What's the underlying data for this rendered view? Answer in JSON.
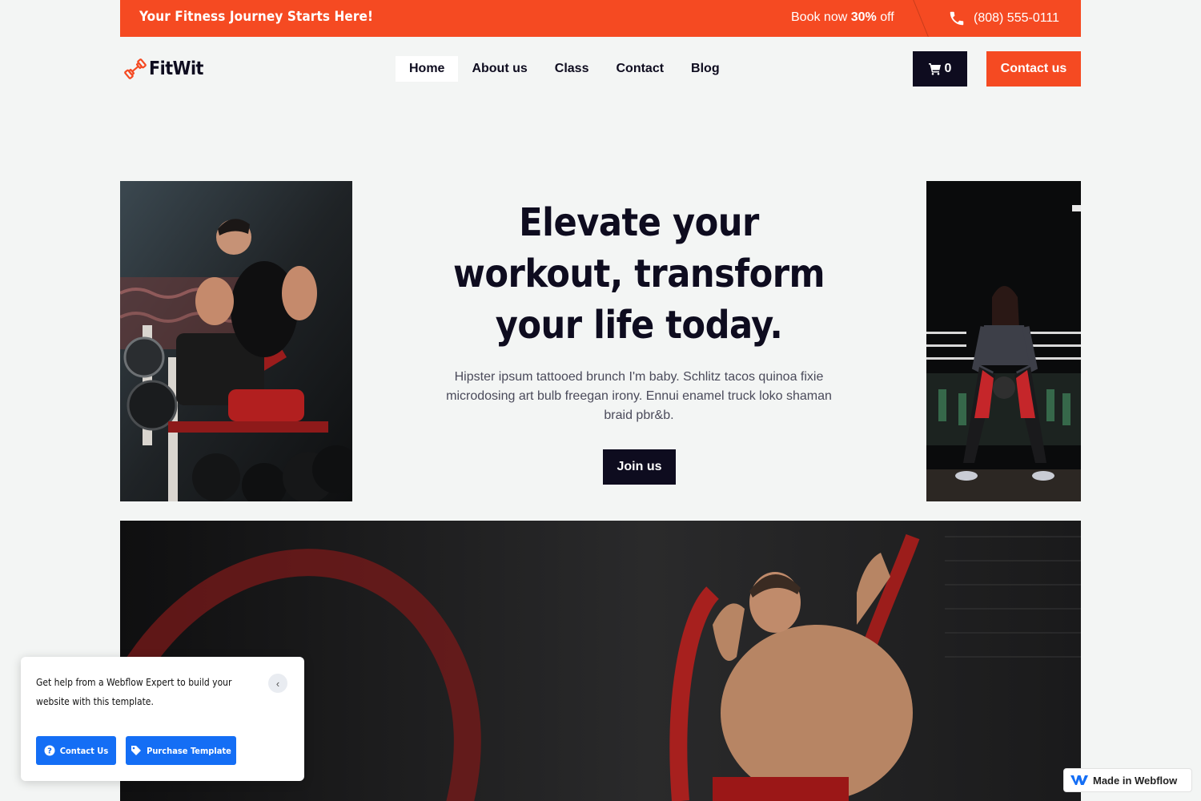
{
  "topbar": {
    "tagline": "Your Fitness Journey Starts Here!",
    "offer_prefix": "Book now ",
    "offer_discount": "30%",
    "offer_suffix": " off",
    "phone": "(808) 555-0111",
    "icon": "phone-icon"
  },
  "brand": {
    "name": "FitWit",
    "icon": "dumbbell-icon",
    "accent_color": "#f54a22",
    "dark_color": "#0e0c1f"
  },
  "nav": {
    "items": [
      {
        "label": "Home",
        "active": true
      },
      {
        "label": "About us",
        "active": false
      },
      {
        "label": "Class",
        "active": false
      },
      {
        "label": "Contact",
        "active": false
      },
      {
        "label": "Blog",
        "active": false
      }
    ]
  },
  "cart": {
    "count": "0",
    "icon": "cart-icon"
  },
  "header_cta": {
    "label": "Contact us"
  },
  "hero": {
    "title": "Elevate your workout, transform your life today.",
    "text": "Hipster ipsum tattooed brunch I'm baby. Schlitz tacos quinoa fixie microdosing art bulb freegan irony. Ennui enamel truck loko shaman braid pbr&b.",
    "cta": "Join us"
  },
  "help_popup": {
    "text": "Get help from a Webflow Expert to build your website with this template.",
    "contact_label": "Contact Us",
    "purchase_label": "Purchase Template",
    "button_color": "#146ef5"
  },
  "badge": {
    "label": "Made in Webflow",
    "icon": "webflow-logo-icon"
  }
}
